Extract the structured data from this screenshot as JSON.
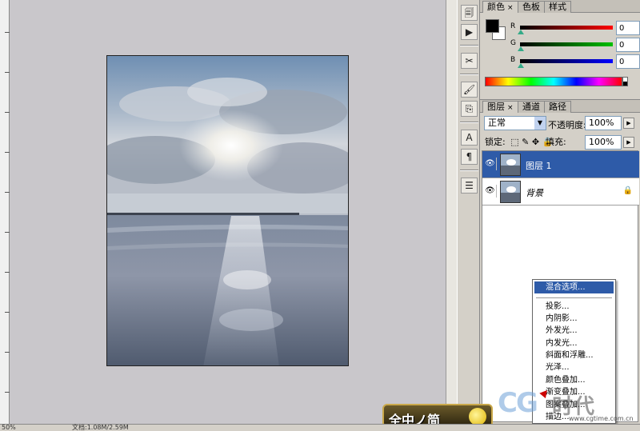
{
  "color_panel": {
    "tabs": [
      {
        "label": "颜色",
        "close": "×"
      },
      {
        "label": "色板"
      },
      {
        "label": "样式"
      }
    ],
    "channels": [
      {
        "label": "R",
        "value": "0",
        "color_from": "#000000",
        "color_to": "#ff0000"
      },
      {
        "label": "G",
        "value": "0",
        "color_from": "#000000",
        "color_to": "#00c000"
      },
      {
        "label": "B",
        "value": "0",
        "color_from": "#000000",
        "color_to": "#0000ff"
      }
    ]
  },
  "layers_panel": {
    "tabs": [
      {
        "label": "图层",
        "close": "×"
      },
      {
        "label": "通道"
      },
      {
        "label": "路径"
      }
    ],
    "blend_mode": "正常",
    "opacity_label": "不透明度:",
    "opacity_value": "100%",
    "lock_label": "锁定:",
    "lock_icons": "⬚ ✎ ✥ 🔒",
    "fill_label": "填充:",
    "fill_value": "100%",
    "layers": [
      {
        "name": "图层 1",
        "visible_icon": "👁",
        "selected": true
      },
      {
        "name": "背景",
        "visible_icon": "👁",
        "selected": false,
        "lock_icon": "🔒"
      }
    ]
  },
  "context_menu": {
    "items": [
      {
        "label": "混合选项...",
        "highlighted": true
      },
      {
        "separator": true
      },
      {
        "label": "投影..."
      },
      {
        "label": "内阴影..."
      },
      {
        "label": "外发光..."
      },
      {
        "label": "内发光..."
      },
      {
        "label": "斜面和浮雕..."
      },
      {
        "label": "光泽..."
      },
      {
        "label": "颜色叠加..."
      },
      {
        "label": "渐变叠加..."
      },
      {
        "label": "图案叠加..."
      },
      {
        "label": "描边..."
      }
    ]
  },
  "status_bar": {
    "zoom": "50%",
    "doc_info": "文档:1.08M/2.59M"
  },
  "watermark": {
    "badge_text": "全中ノ简",
    "logo": "CG",
    "logo_text": "时代",
    "url": "www.cgtime.com.cn"
  },
  "dock_icons": [
    "history-icon",
    "actions-icon",
    "tool-presets-icon",
    "brushes-icon",
    "clone-source-icon",
    "character-icon",
    "paragraph-icon",
    "layer-comps-icon"
  ],
  "dock_glyphs": [
    "🗐",
    "▶",
    "✂",
    "🖌",
    "⎘",
    "A",
    "¶",
    "☰"
  ]
}
